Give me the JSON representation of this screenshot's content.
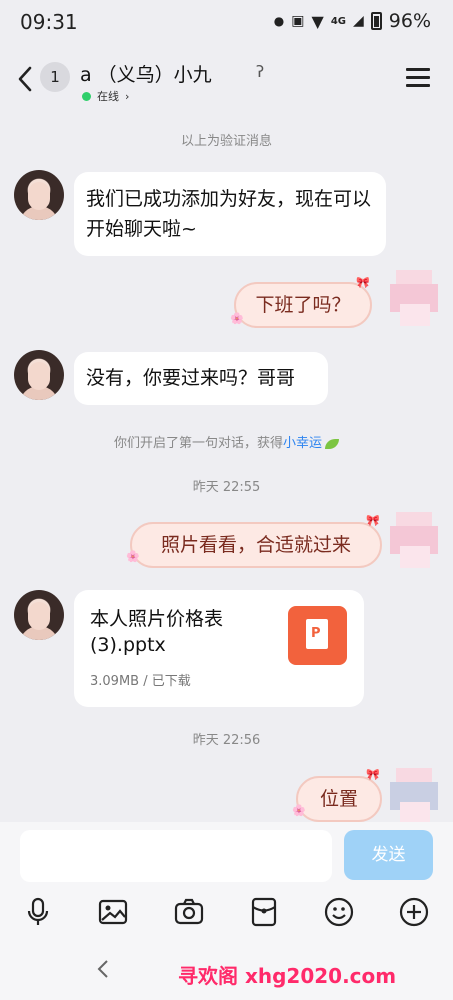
{
  "status_bar": {
    "time": "09:31",
    "network": "4G",
    "battery": "96%"
  },
  "header": {
    "badge_count": "1",
    "contact_name": "a        （义乌）小九",
    "online_status": "在线",
    "online_color": "#2fcf6b"
  },
  "messages": {
    "verify_label": "以上为验证消息",
    "m1": "我们已成功添加为好友，现在可以开始聊天啦~",
    "m2": "下班了吗？",
    "m3": "没有，你要过来吗？哥哥",
    "hint_prefix": "你们开启了第一句对话，获得",
    "hint_link": "小幸运",
    "time1": "昨天 22:55",
    "m4": "照片看看，合适就过来",
    "file": {
      "name": "本人照片价格表(3).pptx",
      "meta": "3.09MB / 已下载",
      "icon_letter": "P"
    },
    "time2": "昨天 22:56",
    "m5": "位置"
  },
  "input": {
    "placeholder": "",
    "send_label": "发送"
  },
  "toolbar_icons": [
    "microphone-icon",
    "image-icon",
    "camera-icon",
    "red-packet-icon",
    "emoji-icon",
    "plus-icon"
  ],
  "watermark": "寻欢阁 xhg2020.com",
  "colors": {
    "send_button": "#9fd2f7",
    "link": "#2d84f0",
    "file_icon": "#f2623d",
    "watermark": "#ff2a6a"
  }
}
